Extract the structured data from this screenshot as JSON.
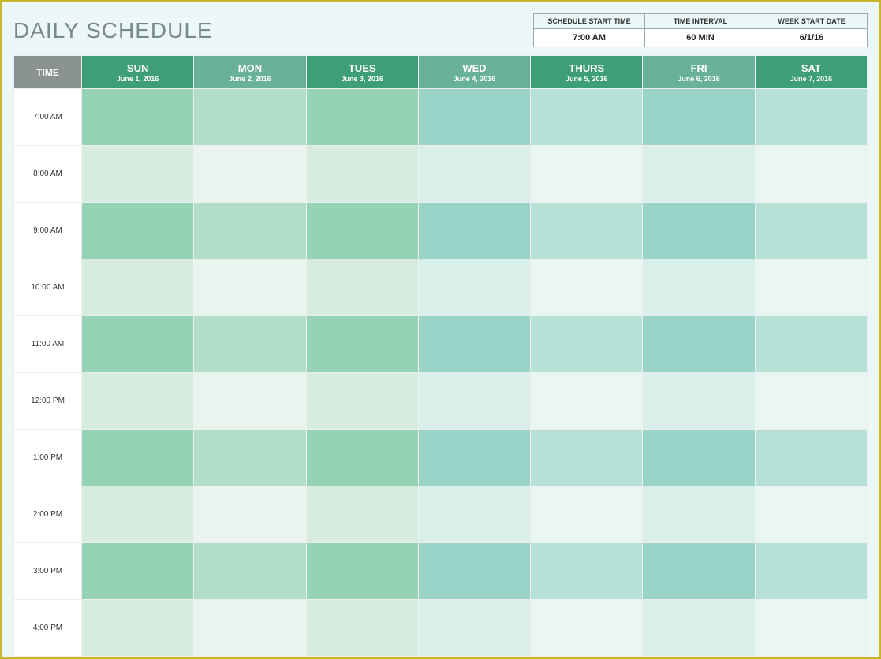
{
  "title": "DAILY SCHEDULE",
  "meta": {
    "schedule_start_time": {
      "label": "SCHEDULE START TIME",
      "value": "7:00 AM"
    },
    "time_interval": {
      "label": "TIME INTERVAL",
      "value": "60 MIN"
    },
    "week_start_date": {
      "label": "WEEK START DATE",
      "value": "6/1/16"
    }
  },
  "columns": {
    "time_header": "TIME",
    "days": [
      {
        "name": "SUN",
        "date": "June 1, 2016"
      },
      {
        "name": "MON",
        "date": "June 2, 2016"
      },
      {
        "name": "TUES",
        "date": "June 3, 2016"
      },
      {
        "name": "WED",
        "date": "June 4, 2016"
      },
      {
        "name": "THURS",
        "date": "June 5, 2016"
      },
      {
        "name": "FRI",
        "date": "June 6, 2016"
      },
      {
        "name": "SAT",
        "date": "June 7, 2016"
      }
    ]
  },
  "times": [
    "7:00 AM",
    "8:00 AM",
    "9:00 AM",
    "10:00 AM",
    "11:00 AM",
    "12:00 PM",
    "1:00 PM",
    "2:00 PM",
    "3:00 PM",
    "4:00 PM"
  ],
  "cells": [
    [
      "",
      "",
      "",
      "",
      "",
      "",
      ""
    ],
    [
      "",
      "",
      "",
      "",
      "",
      "",
      ""
    ],
    [
      "",
      "",
      "",
      "",
      "",
      "",
      ""
    ],
    [
      "",
      "",
      "",
      "",
      "",
      "",
      ""
    ],
    [
      "",
      "",
      "",
      "",
      "",
      "",
      ""
    ],
    [
      "",
      "",
      "",
      "",
      "",
      "",
      ""
    ],
    [
      "",
      "",
      "",
      "",
      "",
      "",
      ""
    ],
    [
      "",
      "",
      "",
      "",
      "",
      "",
      ""
    ],
    [
      "",
      "",
      "",
      "",
      "",
      "",
      ""
    ],
    [
      "",
      "",
      "",
      "",
      "",
      "",
      ""
    ]
  ]
}
